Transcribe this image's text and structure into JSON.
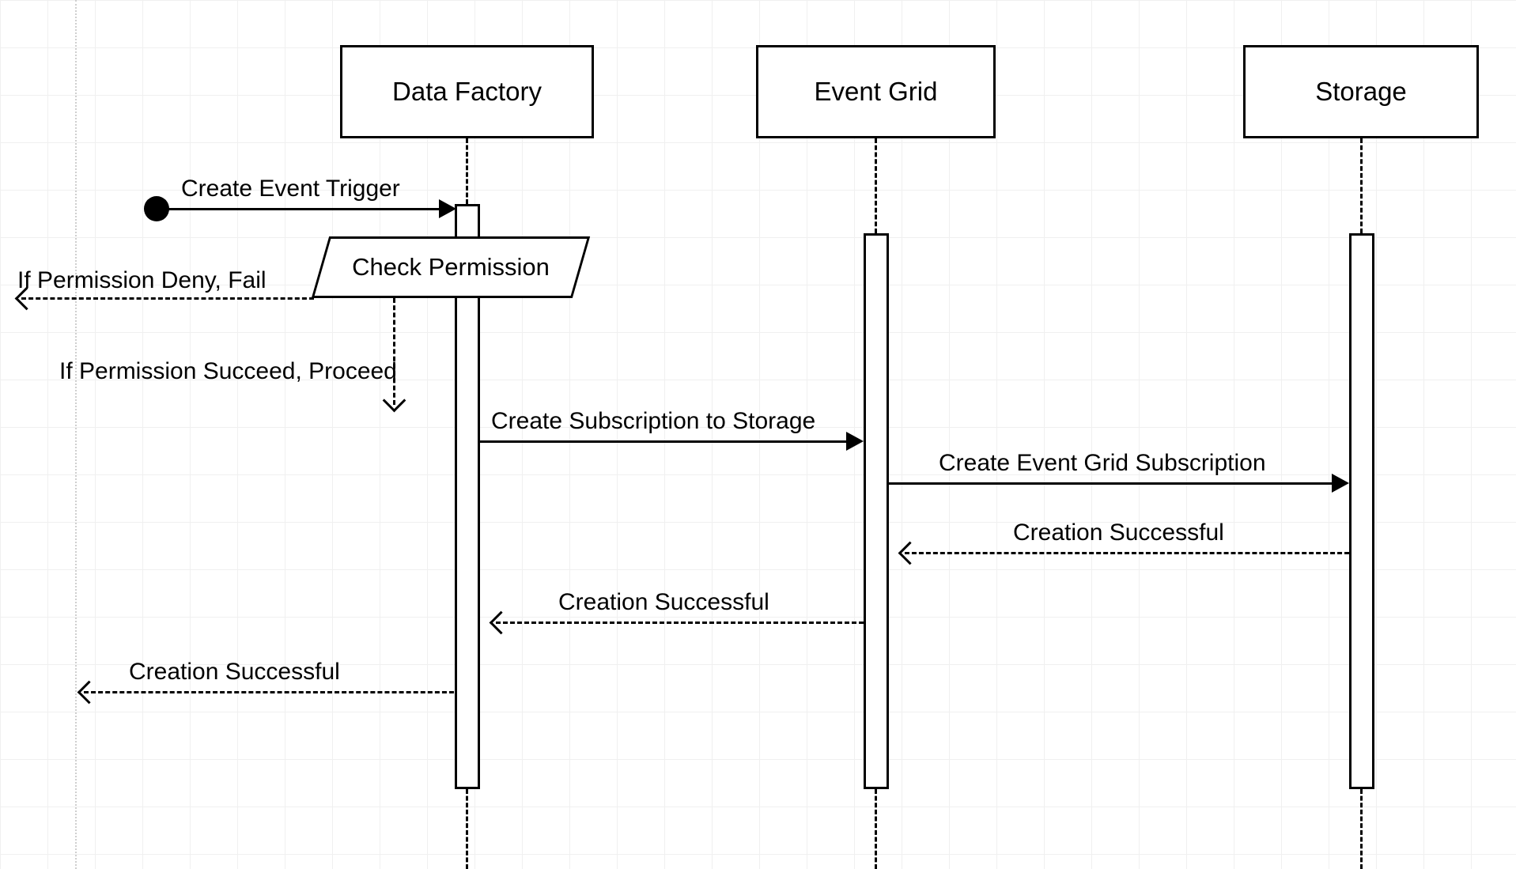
{
  "diagram": {
    "type": "sequence",
    "participants": {
      "data_factory": "Data Factory",
      "event_grid": "Event Grid",
      "storage": "Storage"
    },
    "process_box": "Check Permission",
    "messages": {
      "create_trigger": "Create Event Trigger",
      "deny_fail": "If Permission Deny, Fail",
      "succeed_proceed": "If Permission Succeed, Proceed",
      "create_sub_to_storage": "Create Subscription to Storage",
      "create_eg_sub": "Create Event Grid Subscription",
      "creation_success_1": "Creation Successful",
      "creation_success_2": "Creation Successful",
      "creation_success_3": "Creation Successful"
    }
  }
}
